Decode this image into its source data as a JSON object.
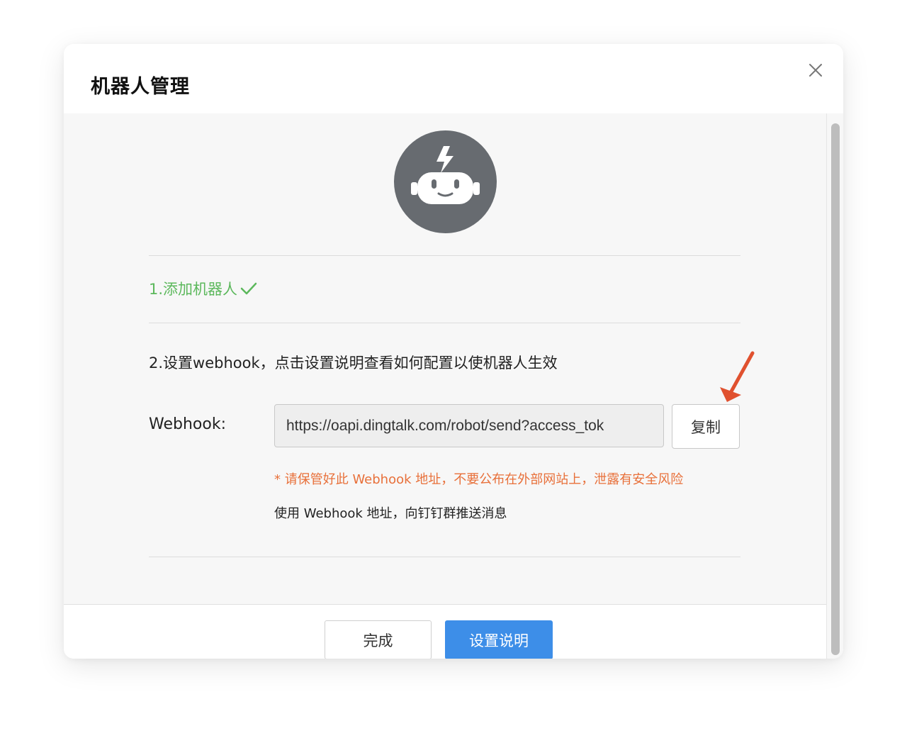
{
  "dialog": {
    "title": "机器人管理",
    "close_icon": "close-icon"
  },
  "robot": {
    "icon": "robot-avatar-icon",
    "bg_color": "#676b70"
  },
  "steps": {
    "step1": "1.添加机器人",
    "step1_color": "#5cb85c",
    "step1_icon": "check-icon",
    "step2": "2.设置webhook，点击设置说明查看如何配置以使机器人生效"
  },
  "webhook": {
    "label": "Webhook:",
    "value": "https://oapi.dingtalk.com/robot/send?access_tok",
    "copy_label": "复制",
    "warning": "* 请保管好此 Webhook 地址，不要公布在外部网站上，泄露有安全风险",
    "warning_color": "#e8703a",
    "hint": "使用 Webhook 地址，向钉钉群推送消息"
  },
  "annotation": {
    "icon": "red-arrow-icon",
    "color": "#e0512f"
  },
  "footer": {
    "done_label": "完成",
    "help_label": "设置说明",
    "primary_color": "#3d8ee8"
  }
}
